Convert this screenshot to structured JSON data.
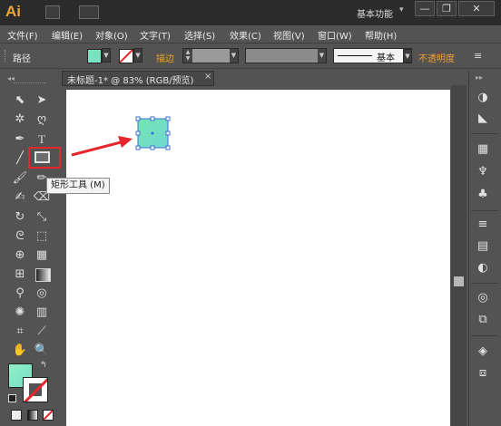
{
  "app": {
    "logo": "Ai",
    "workspace": "基本功能",
    "workspace_caret": "▾"
  },
  "window_controls": {
    "minimize": "—",
    "restore": "❐",
    "close": "✕"
  },
  "menu": [
    {
      "label": "文件(F)"
    },
    {
      "label": "编辑(E)"
    },
    {
      "label": "对象(O)"
    },
    {
      "label": "文字(T)"
    },
    {
      "label": "选择(S)"
    },
    {
      "label": "效果(C)"
    },
    {
      "label": "视图(V)"
    },
    {
      "label": "窗口(W)"
    },
    {
      "label": "帮助(H)"
    }
  ],
  "control_bar": {
    "object_type": "路径",
    "stroke_label": "描边",
    "brush_name": "基本",
    "opacity_label": "不透明度",
    "fill_color": "#7de2bf",
    "accent": "#f0a030"
  },
  "document": {
    "tab_title": "未标题-1* @ 83% (RGB/预览)",
    "close_symbol": "×"
  },
  "tooltip": {
    "text": "矩形工具 (M)"
  },
  "colors": {
    "highlight": "#e6262b",
    "arrow": "#e6262b",
    "selection": "#3a6fd8",
    "shape_fill_top": "#78e3b8",
    "shape_fill_bottom": "#6fd9d0"
  },
  "tools": [
    "selection-tool",
    "direct-selection-tool",
    "magic-wand-tool",
    "lasso-tool",
    "pen-tool",
    "type-tool",
    "line-tool",
    "rectangle-tool",
    "paintbrush-tool",
    "pencil-tool",
    "blob-brush-tool",
    "eraser-tool",
    "rotate-tool",
    "scale-tool",
    "warp-tool",
    "free-transform-tool",
    "shape-builder-tool",
    "perspective-grid-tool",
    "mesh-tool",
    "gradient-tool",
    "eyedropper-tool",
    "blend-tool",
    "symbol-sprayer-tool",
    "column-graph-tool",
    "artboard-tool",
    "slice-tool",
    "hand-tool",
    "zoom-tool"
  ],
  "right_panels": [
    "color-panel",
    "color-guide-panel",
    "swatches-panel",
    "brushes-panel",
    "symbols-panel",
    "stroke-panel",
    "gradient-panel",
    "transparency-panel",
    "appearance-panel",
    "graphic-styles-panel",
    "layers-panel",
    "artboards-panel"
  ]
}
